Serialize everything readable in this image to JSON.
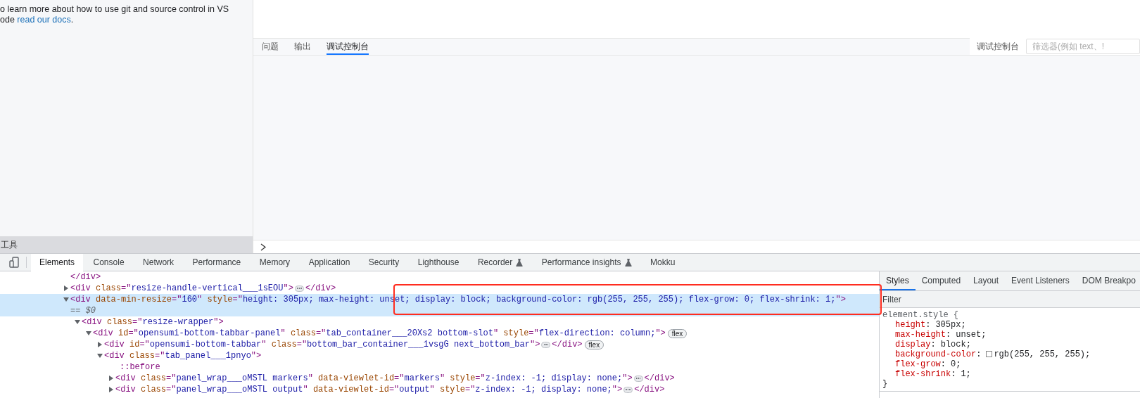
{
  "editor": {
    "lines": [
      "o learn more about how to use git and source control in VS",
      "ode "
    ],
    "link": "read our docs",
    "tail": "."
  },
  "sidebar_footer": {
    "label": "工具"
  },
  "panel": {
    "tabs": [
      {
        "label": "问题",
        "selected": false
      },
      {
        "label": "输出",
        "selected": false
      },
      {
        "label": "调试控制台",
        "selected": true
      }
    ],
    "source": "调试控制台",
    "filter": {
      "placeholder": "筛选器(例如 text、!"
    }
  },
  "devtools": {
    "tabs": [
      {
        "label": "Elements",
        "selected": true,
        "experimental": false
      },
      {
        "label": "Console",
        "selected": false,
        "experimental": false
      },
      {
        "label": "Network",
        "selected": false,
        "experimental": false
      },
      {
        "label": "Performance",
        "selected": false,
        "experimental": false
      },
      {
        "label": "Memory",
        "selected": false,
        "experimental": false
      },
      {
        "label": "Application",
        "selected": false,
        "experimental": false
      },
      {
        "label": "Security",
        "selected": false,
        "experimental": false
      },
      {
        "label": "Lighthouse",
        "selected": false,
        "experimental": false
      },
      {
        "label": "Recorder",
        "selected": false,
        "experimental": true
      },
      {
        "label": "Performance insights",
        "selected": false,
        "experimental": true
      },
      {
        "label": "Mokku",
        "selected": false,
        "experimental": false
      }
    ],
    "dom_tree": [
      {
        "kind": "close",
        "selected": false,
        "tokens": [
          {
            "kind": "tag",
            "text": "</div>"
          }
        ]
      },
      {
        "kind": "element",
        "expanded": false,
        "selected": false,
        "tokens": [
          {
            "kind": "tag",
            "text": "<div "
          },
          {
            "kind": "attr",
            "text": "class"
          },
          {
            "kind": "tag",
            "text": "=\""
          },
          {
            "kind": "val",
            "text": "resize-handle-vertical___1sEOU"
          },
          {
            "kind": "tag",
            "text": "\">"
          }
        ],
        "closing": "</div>"
      },
      {
        "kind": "element",
        "expanded": true,
        "selected": true,
        "tokens": [
          {
            "kind": "tag",
            "text": "<div "
          },
          {
            "kind": "attr",
            "text": "data-min-resize"
          },
          {
            "kind": "tag",
            "text": "=\""
          },
          {
            "kind": "val",
            "text": "160"
          },
          {
            "kind": "tag",
            "text": "\" "
          },
          {
            "kind": "attr",
            "text": "style"
          },
          {
            "kind": "tag",
            "text": "=\""
          },
          {
            "kind": "val",
            "text": "height: 305px; max-height: unset; display: block; background-color: rgb(255, 255, 255); flex-grow: 0; flex-shrink: 1;"
          },
          {
            "kind": "tag",
            "text": "\">"
          }
        ],
        "note": "== $0",
        "children": [
          {
            "kind": "element",
            "expanded": true,
            "selected": false,
            "tokens": [
              {
                "kind": "tag",
                "text": "<div "
              },
              {
                "kind": "attr",
                "text": "class"
              },
              {
                "kind": "tag",
                "text": "=\""
              },
              {
                "kind": "val",
                "text": "resize-wrapper"
              },
              {
                "kind": "tag",
                "text": "\">"
              }
            ],
            "children": [
              {
                "kind": "element",
                "expanded": true,
                "selected": false,
                "tokens": [
                  {
                    "kind": "tag",
                    "text": "<div "
                  },
                  {
                    "kind": "attr",
                    "text": "id"
                  },
                  {
                    "kind": "tag",
                    "text": "=\""
                  },
                  {
                    "kind": "val",
                    "text": "opensumi-bottom-tabbar-panel"
                  },
                  {
                    "kind": "tag",
                    "text": "\" "
                  },
                  {
                    "kind": "attr",
                    "text": "class"
                  },
                  {
                    "kind": "tag",
                    "text": "=\""
                  },
                  {
                    "kind": "val",
                    "text": "tab_container___20Xs2 bottom-slot"
                  },
                  {
                    "kind": "tag",
                    "text": "\" "
                  },
                  {
                    "kind": "attr",
                    "text": "style"
                  },
                  {
                    "kind": "tag",
                    "text": "=\""
                  },
                  {
                    "kind": "val",
                    "text": "flex-direction: column;"
                  },
                  {
                    "kind": "tag",
                    "text": "\">"
                  }
                ],
                "badge": "flex",
                "children": [
                  {
                    "kind": "element",
                    "expanded": false,
                    "selected": false,
                    "tokens": [
                      {
                        "kind": "tag",
                        "text": "<div "
                      },
                      {
                        "kind": "attr",
                        "text": "id"
                      },
                      {
                        "kind": "tag",
                        "text": "=\""
                      },
                      {
                        "kind": "val",
                        "text": "opensumi-bottom-tabbar"
                      },
                      {
                        "kind": "tag",
                        "text": "\" "
                      },
                      {
                        "kind": "attr",
                        "text": "class"
                      },
                      {
                        "kind": "tag",
                        "text": "=\""
                      },
                      {
                        "kind": "val",
                        "text": "bottom_bar_container___1vsgG next_bottom_bar"
                      },
                      {
                        "kind": "tag",
                        "text": "\">"
                      }
                    ],
                    "closing": "</div>",
                    "badge": "flex"
                  },
                  {
                    "kind": "element",
                    "expanded": true,
                    "selected": false,
                    "tokens": [
                      {
                        "kind": "tag",
                        "text": "<div "
                      },
                      {
                        "kind": "attr",
                        "text": "class"
                      },
                      {
                        "kind": "tag",
                        "text": "=\""
                      },
                      {
                        "kind": "val",
                        "text": "tab_panel___1pnyo"
                      },
                      {
                        "kind": "tag",
                        "text": "\">"
                      }
                    ],
                    "children": [
                      {
                        "kind": "pseudo",
                        "selected": false,
                        "tokens": [
                          {
                            "kind": "pseudo",
                            "text": "::before"
                          }
                        ]
                      },
                      {
                        "kind": "element",
                        "expanded": false,
                        "selected": false,
                        "tokens": [
                          {
                            "kind": "tag",
                            "text": "<div "
                          },
                          {
                            "kind": "attr",
                            "text": "class"
                          },
                          {
                            "kind": "tag",
                            "text": "=\""
                          },
                          {
                            "kind": "val",
                            "text": "panel_wrap___oMSTL markers"
                          },
                          {
                            "kind": "tag",
                            "text": "\" "
                          },
                          {
                            "kind": "attr",
                            "text": "data-viewlet-id"
                          },
                          {
                            "kind": "tag",
                            "text": "=\""
                          },
                          {
                            "kind": "val",
                            "text": "markers"
                          },
                          {
                            "kind": "tag",
                            "text": "\" "
                          },
                          {
                            "kind": "attr",
                            "text": "style"
                          },
                          {
                            "kind": "tag",
                            "text": "=\""
                          },
                          {
                            "kind": "val",
                            "text": "z-index: -1; display: none;"
                          },
                          {
                            "kind": "tag",
                            "text": "\">"
                          }
                        ],
                        "closing": "</div>"
                      },
                      {
                        "kind": "element",
                        "expanded": false,
                        "selected": false,
                        "tokens": [
                          {
                            "kind": "tag",
                            "text": "<div "
                          },
                          {
                            "kind": "attr",
                            "text": "class"
                          },
                          {
                            "kind": "tag",
                            "text": "=\""
                          },
                          {
                            "kind": "val",
                            "text": "panel_wrap___oMSTL output"
                          },
                          {
                            "kind": "tag",
                            "text": "\" "
                          },
                          {
                            "kind": "attr",
                            "text": "data-viewlet-id"
                          },
                          {
                            "kind": "tag",
                            "text": "=\""
                          },
                          {
                            "kind": "val",
                            "text": "output"
                          },
                          {
                            "kind": "tag",
                            "text": "\" "
                          },
                          {
                            "kind": "attr",
                            "text": "style"
                          },
                          {
                            "kind": "tag",
                            "text": "=\""
                          },
                          {
                            "kind": "val",
                            "text": "z-index: -1; display: none;"
                          },
                          {
                            "kind": "tag",
                            "text": "\">"
                          }
                        ],
                        "closing": "</div>"
                      }
                    ]
                  }
                ]
              }
            ]
          }
        ]
      }
    ],
    "sidebar": {
      "tabs": [
        {
          "label": "Styles",
          "selected": true
        },
        {
          "label": "Computed",
          "selected": false
        },
        {
          "label": "Layout",
          "selected": false
        },
        {
          "label": "Event Listeners",
          "selected": false
        },
        {
          "label": "DOM Breakpo",
          "selected": false
        }
      ],
      "filter": {
        "placeholder": "Filter"
      },
      "rule": {
        "selector": "element.style {",
        "close": "}",
        "declarations": [
          {
            "property": "height",
            "colon": ":",
            "value": "305px;",
            "swatch": false
          },
          {
            "property": "max-height",
            "colon": ":",
            "value": "unset;",
            "swatch": false
          },
          {
            "property": "display",
            "colon": ":",
            "value": "block;",
            "swatch": false
          },
          {
            "property": "background-color",
            "colon": ":",
            "value": "rgb(255, 255, 255);",
            "swatch": true
          },
          {
            "property": "flex-grow",
            "colon": ":",
            "value": "0;",
            "swatch": false
          },
          {
            "property": "flex-shrink",
            "colon": ":",
            "value": "1;",
            "swatch": false
          }
        ]
      }
    }
  }
}
